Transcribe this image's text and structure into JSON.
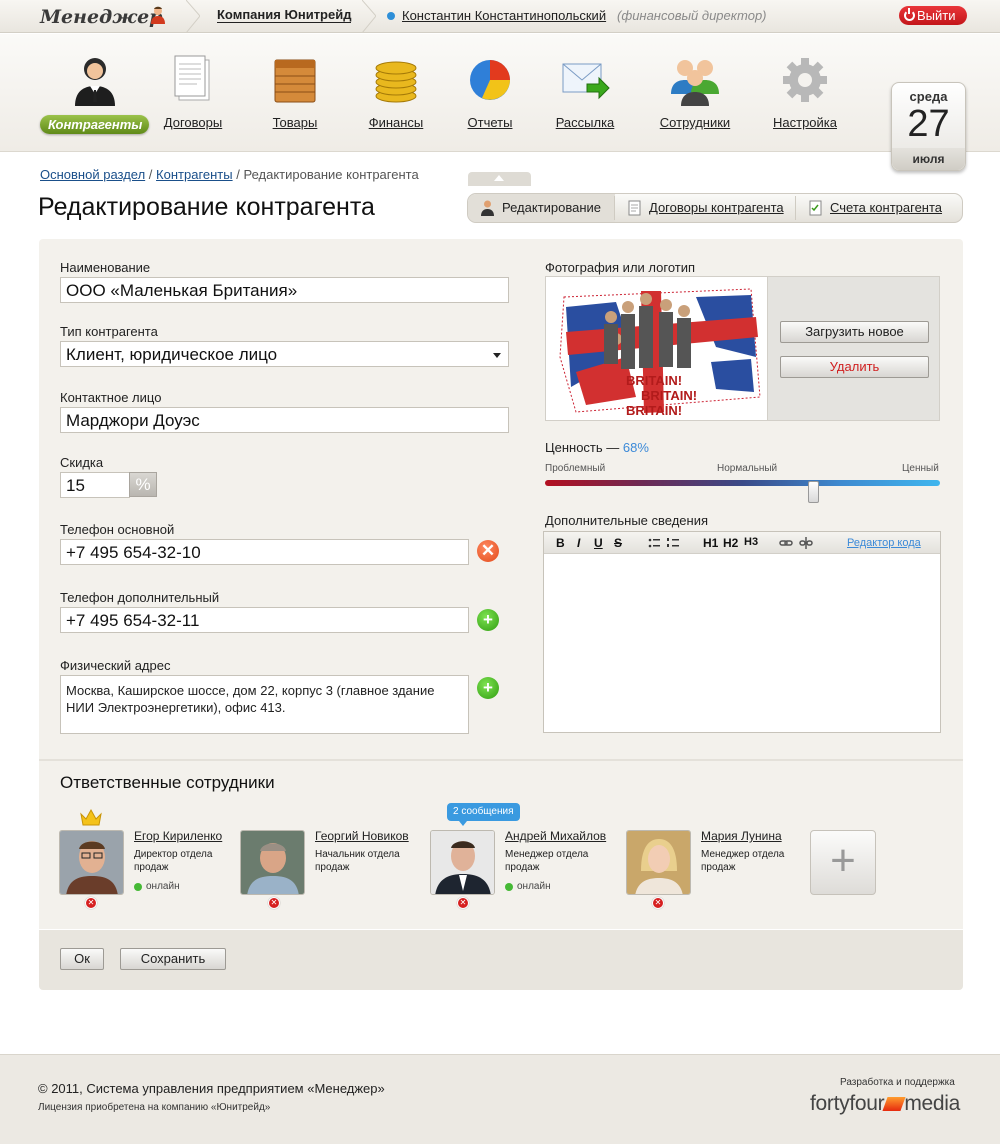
{
  "header": {
    "logo": "Менеджер",
    "company": "Компания Юнитрейд",
    "user": "Константин Константинопольский",
    "role": "(финансовый директор)",
    "logout": "Выйти"
  },
  "nav": {
    "items": [
      {
        "label": "Контрагенты",
        "icon": "person-icon",
        "active": true
      },
      {
        "label": "Договоры",
        "icon": "document-icon"
      },
      {
        "label": "Товары",
        "icon": "crate-icon"
      },
      {
        "label": "Финансы",
        "icon": "coins-icon"
      },
      {
        "label": "Отчеты",
        "icon": "pie-chart-icon"
      },
      {
        "label": "Рассылка",
        "icon": "mail-arrow-icon"
      },
      {
        "label": "Сотрудники",
        "icon": "people-icon"
      },
      {
        "label": "Настройка",
        "icon": "gear-icon"
      }
    ]
  },
  "calendar": {
    "weekday": "среда",
    "day": "27",
    "month": "июля"
  },
  "breadcrumb": {
    "root": "Основной раздел",
    "section": "Контрагенты",
    "current": "Редактирование контрагента"
  },
  "page_title": "Редактирование контрагента",
  "tabs": [
    {
      "label": "Редактирование",
      "active": true
    },
    {
      "label": "Договоры контрагента"
    },
    {
      "label": "Счета контрагента"
    }
  ],
  "form": {
    "name_label": "Наименование",
    "name_value": "ООО «Маленькая Британия»",
    "type_label": "Тип контрагента",
    "type_value": "Клиент, юридическое лицо",
    "contact_label": "Контактное лицо",
    "contact_value": "Марджори Доуэс",
    "discount_label": "Скидка",
    "discount_value": "15",
    "discount_unit": "%",
    "phone_main_label": "Телефон основной",
    "phone_main_value": "+7 495 654-32-10",
    "phone_extra_label": "Телефон дополнительный",
    "phone_extra_value": "+7 495 654-32-11",
    "address_label": "Физический адрес",
    "address_value": "Москва, Каширское шоссе, дом 22, корпус 3 (главное здание НИИ Электроэнергетики), офис 413."
  },
  "photo": {
    "label": "Фотография или логотип",
    "upload": "Загрузить новое",
    "delete": "Удалить",
    "image_text": "BRITAIN! BRITAIN! BRITAIN!"
  },
  "value": {
    "label": "Ценность —",
    "percent_text": "68%",
    "percent": 68,
    "scale_low": "Проблемный",
    "scale_mid": "Нормальный",
    "scale_high": "Ценный"
  },
  "extra": {
    "label": "Дополнительные сведения",
    "toolbar": {
      "bold": "B",
      "italic": "I",
      "underline": "U",
      "strike": "S",
      "h1": "H1",
      "h2": "H2",
      "h3": "H3",
      "code": "Редактор кода"
    }
  },
  "employees": {
    "title": "Ответственные сотрудники",
    "list": [
      {
        "name": "Егор Кириленко",
        "post": "Директор отдела продаж",
        "status": "онлайн"
      },
      {
        "name": "Георгий Новиков",
        "post": "Начальник отдела продаж"
      },
      {
        "name": "Андрей Михайлов",
        "post": "Менеджер отдела продаж",
        "status": "онлайн",
        "messages": "2 сообщения"
      },
      {
        "name": "Мария Лунина",
        "post": "Менеджер отдела продаж"
      }
    ]
  },
  "actions": {
    "ok": "Ок",
    "save": "Сохранить"
  },
  "footer": {
    "copyright": "© 2011, Система управления предприятием «Менеджер»",
    "license": "Лицензия приобретена на компанию «Юнитрейд»",
    "dev": "Разработка и поддержка",
    "brand_left": "fortyfour",
    "brand_right": "media"
  },
  "colors": {
    "accent_green": "#6a9a1f",
    "link_blue": "#1a4f8a",
    "logout_red": "#d11e22",
    "bubble_blue": "#3a9ae0"
  }
}
